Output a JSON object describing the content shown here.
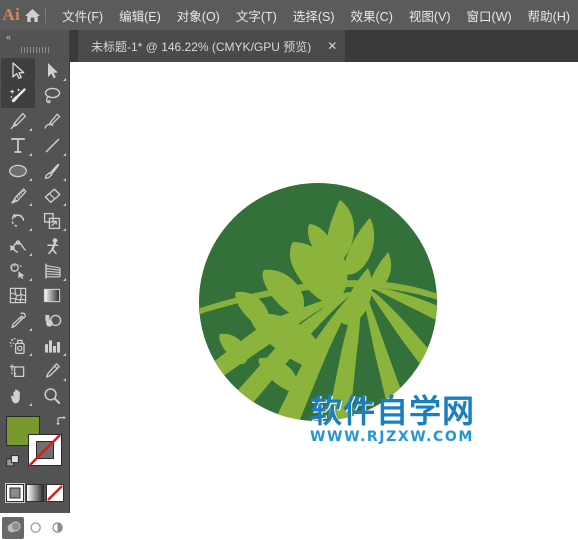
{
  "app": {
    "name": "Ai",
    "home_icon": "home-icon"
  },
  "menubar": {
    "items": [
      {
        "label": "文件(F)",
        "name": "menu-file"
      },
      {
        "label": "编辑(E)",
        "name": "menu-edit"
      },
      {
        "label": "对象(O)",
        "name": "menu-object"
      },
      {
        "label": "文字(T)",
        "name": "menu-type"
      },
      {
        "label": "选择(S)",
        "name": "menu-select"
      },
      {
        "label": "效果(C)",
        "name": "menu-effect"
      },
      {
        "label": "视图(V)",
        "name": "menu-view"
      },
      {
        "label": "窗口(W)",
        "name": "menu-window"
      },
      {
        "label": "帮助(H)",
        "name": "menu-help"
      }
    ]
  },
  "tabbar": {
    "tab": {
      "label": "未标题-1* @ 146.22% (CMYK/GPU 预览)",
      "close_label": "✕",
      "document_name": "未标题-1",
      "modified": true,
      "zoom": "146.22%",
      "color_mode": "CMYK",
      "renderer": "GPU",
      "preview_label": "预览"
    }
  },
  "toolbar": {
    "collapse_label": "«",
    "tools": [
      {
        "name": "selection-tool",
        "label": "选择工具",
        "active": true,
        "corner": false
      },
      {
        "name": "direct-selection-tool",
        "label": "直接选择工具",
        "active": false,
        "corner": true
      },
      {
        "name": "magic-wand-tool",
        "label": "魔棒工具",
        "active": true,
        "corner": false
      },
      {
        "name": "lasso-tool",
        "label": "套索工具",
        "active": false,
        "corner": false
      },
      {
        "name": "pen-tool",
        "label": "钢笔工具",
        "active": false,
        "corner": true
      },
      {
        "name": "curvature-tool",
        "label": "曲率工具",
        "active": false,
        "corner": false
      },
      {
        "name": "type-tool",
        "label": "文字工具",
        "active": false,
        "corner": true
      },
      {
        "name": "line-segment-tool",
        "label": "直线段工具",
        "active": false,
        "corner": true
      },
      {
        "name": "ellipse-tool",
        "label": "椭圆工具",
        "active": false,
        "corner": true
      },
      {
        "name": "paintbrush-tool",
        "label": "画笔工具",
        "active": false,
        "corner": true
      },
      {
        "name": "blob-brush-tool",
        "label": "斑点画笔工具",
        "active": false,
        "corner": true
      },
      {
        "name": "eraser-tool",
        "label": "橡皮擦工具",
        "active": false,
        "corner": true
      },
      {
        "name": "rotate-tool",
        "label": "旋转工具",
        "active": false,
        "corner": true
      },
      {
        "name": "scale-tool",
        "label": "比例缩放工具",
        "active": false,
        "corner": true
      },
      {
        "name": "width-tool",
        "label": "宽度工具",
        "active": false,
        "corner": true
      },
      {
        "name": "free-transform-tool",
        "label": "自由变换工具",
        "active": false,
        "corner": false
      },
      {
        "name": "shape-builder-tool",
        "label": "形状生成器工具",
        "active": false,
        "corner": true
      },
      {
        "name": "perspective-grid-tool",
        "label": "透视网格工具",
        "active": false,
        "corner": true
      },
      {
        "name": "mesh-tool",
        "label": "网格工具",
        "active": false,
        "corner": false
      },
      {
        "name": "gradient-tool",
        "label": "渐变工具",
        "active": false,
        "corner": false
      },
      {
        "name": "eyedropper-tool",
        "label": "吸管工具",
        "active": false,
        "corner": true
      },
      {
        "name": "blend-tool",
        "label": "混合工具",
        "active": false,
        "corner": false
      },
      {
        "name": "symbol-sprayer-tool",
        "label": "符号喷枪工具",
        "active": false,
        "corner": true
      },
      {
        "name": "column-graph-tool",
        "label": "柱形图工具",
        "active": false,
        "corner": true
      },
      {
        "name": "artboard-tool",
        "label": "画板工具",
        "active": false,
        "corner": false
      },
      {
        "name": "slice-tool",
        "label": "切片工具",
        "active": false,
        "corner": true
      },
      {
        "name": "hand-tool",
        "label": "抓手工具",
        "active": false,
        "corner": true
      },
      {
        "name": "zoom-tool",
        "label": "缩放工具",
        "active": false,
        "corner": false
      }
    ],
    "fill_stroke": {
      "fill_color": "#77992e",
      "stroke_color": "none",
      "stroke_is_none": true,
      "swap_label": "swap-fill-stroke",
      "default_label": "default-fill-stroke",
      "modes": [
        {
          "name": "color-mode-button",
          "label": "颜色",
          "selected": true
        },
        {
          "name": "gradient-mode-button",
          "label": "渐变",
          "selected": false
        },
        {
          "name": "none-mode-button",
          "label": "无",
          "selected": false
        }
      ],
      "draw_modes": [
        {
          "name": "draw-normal-button",
          "label": "正常绘图",
          "selected": true
        },
        {
          "name": "draw-behind-button",
          "label": "背面绘图",
          "selected": false
        },
        {
          "name": "draw-inside-button",
          "label": "内部绘图",
          "selected": false
        }
      ]
    }
  },
  "canvas": {
    "background": "#ffffff",
    "artwork": {
      "name": "farm-field-logo",
      "circle_color": "#33703a",
      "accent_color": "#8cb33c",
      "leaf_color": "#8cb33c",
      "field_color": "#8cb33c",
      "description": "绿色圆形农田标志"
    }
  },
  "watermark": {
    "chinese": "软件自学网",
    "url": "WWW.RJZXW.COM",
    "color": "#1a7fc1"
  }
}
